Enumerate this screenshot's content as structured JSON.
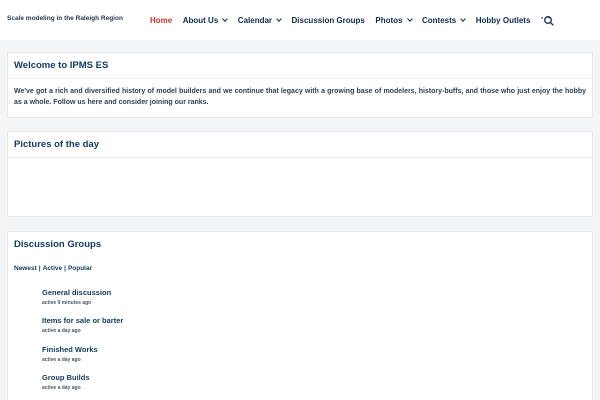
{
  "header": {
    "tagline": "Scale modeling in the Raleigh Region",
    "nav": [
      {
        "label": "Home",
        "active": true,
        "dropdown": false
      },
      {
        "label": "About Us",
        "active": false,
        "dropdown": true
      },
      {
        "label": "Calendar",
        "active": false,
        "dropdown": true
      },
      {
        "label": "Discussion Groups",
        "active": false,
        "dropdown": false
      },
      {
        "label": "Photos",
        "active": false,
        "dropdown": true
      },
      {
        "label": "Contests",
        "active": false,
        "dropdown": true
      },
      {
        "label": "Hobby Outlets",
        "active": false,
        "dropdown": false
      }
    ],
    "more_label": "···",
    "search_icon": "search-icon"
  },
  "welcome": {
    "title": "Welcome to IPMS ES",
    "text": "We've got a rich and diversified history of model builders and we continue that legacy with a growing base of modelers, history-buffs, and those who just enjoy the hobby as a whole. Follow us here and  consider joining our ranks."
  },
  "pictures": {
    "title": "Pictures of the day"
  },
  "discussion": {
    "title": "Discussion Groups",
    "filters": [
      "Newest",
      "Active",
      "Popular"
    ],
    "filter_separator": "|",
    "groups": [
      {
        "title": "General discussion",
        "activity": "active 9 minutes ago"
      },
      {
        "title": "Items for sale or barter",
        "activity": "active a day ago"
      },
      {
        "title": "Finished Works",
        "activity": "active a day ago"
      },
      {
        "title": "Group Builds",
        "activity": "active a day ago"
      }
    ]
  },
  "colors": {
    "accent": "#c0392b",
    "nav_text": "#0f2d4d",
    "heading": "#123a5e",
    "background": "#f4f5f7"
  }
}
